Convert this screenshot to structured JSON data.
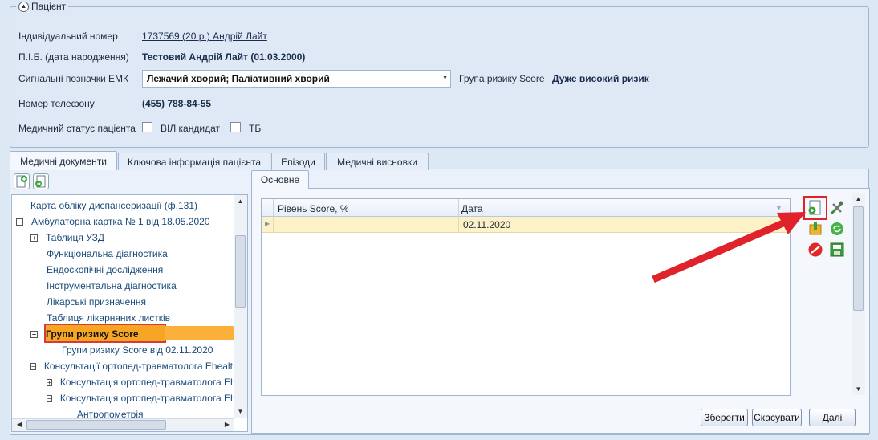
{
  "patient": {
    "section_title": "Пацієнт",
    "id_label": "Індивідуальний номер",
    "id_value": "1737569 (20 р.) Андрій Лайт",
    "name_label": "П.І.Б. (дата народження)",
    "name_value": "Тестовий Андрій Лайт (01.03.2000)",
    "signals_label": "Сигнальні позначки ЕМК",
    "signals_value": "Лежачий хворий; Паліативний хворий",
    "risk_label": "Група ризику Score",
    "risk_value": "Дуже високий ризик",
    "phone_label": "Номер телефону",
    "phone_value": "(455) 788-84-55",
    "status_label": "Медичний статус пацієнта",
    "hiv_label": "ВІЛ кандидат",
    "tb_label": "ТБ"
  },
  "tabs": [
    "Медичні документи",
    "Ключова інформація пацієнта",
    "Епізоди",
    "Медичні висновки"
  ],
  "tree": {
    "items": [
      {
        "label": "Карта обліку диспансеризації (ф.131)",
        "expander": ""
      },
      {
        "label": "Амбулаторна картка № 1 від 18.05.2020",
        "expander": "−"
      },
      {
        "label": "Таблиця УЗД",
        "expander": "+"
      },
      {
        "label": "Функціональна діагностика",
        "expander": ""
      },
      {
        "label": "Ендоскопічні дослідження",
        "expander": ""
      },
      {
        "label": "Інструментальна діагностика",
        "expander": ""
      },
      {
        "label": "Лікарські призначення",
        "expander": ""
      },
      {
        "label": "Таблиця лікарняних листків",
        "expander": ""
      },
      {
        "label": "Групи ризику Score",
        "expander": "−"
      },
      {
        "label": "Групи ризику Score від 02.11.2020",
        "expander": ""
      },
      {
        "label": "Консультації ортопед-травматолога Ehealth",
        "expander": "−"
      },
      {
        "label": "Консультація ортопед-травматолога Eh",
        "expander": "+"
      },
      {
        "label": "Консультація ортопед-травматолога Eh",
        "expander": "−"
      },
      {
        "label": "Антропометрія",
        "expander": ""
      }
    ]
  },
  "content": {
    "inner_tab": "Основне",
    "columns": [
      "Рівень Score, %",
      "Дата"
    ],
    "rows": [
      {
        "score": "",
        "date": "02.11.2020"
      }
    ]
  },
  "buttons": {
    "save": "Зберегти",
    "cancel": "Скасувати",
    "next": "Далі"
  }
}
